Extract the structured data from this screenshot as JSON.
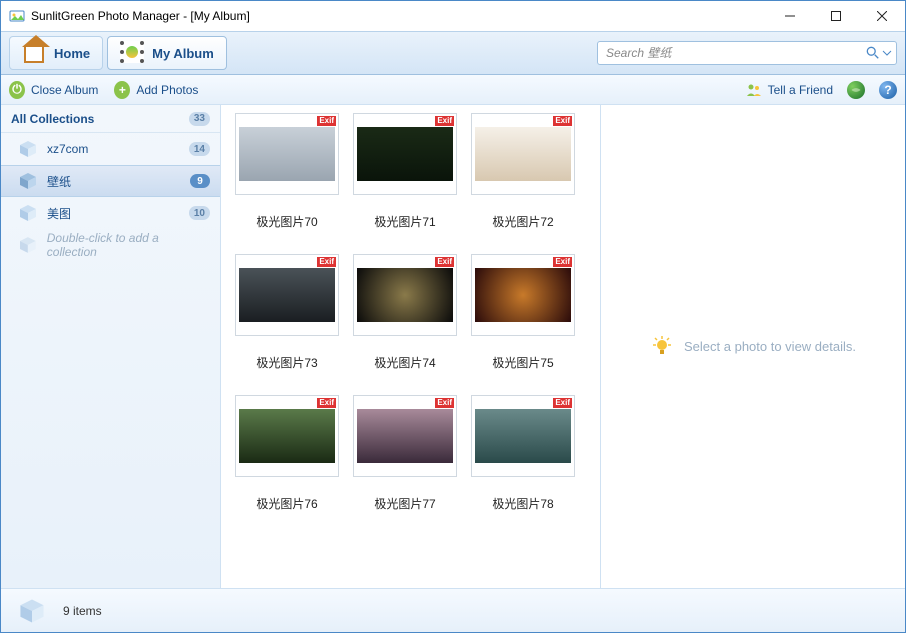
{
  "window": {
    "title": "SunlitGreen Photo Manager - [My Album]"
  },
  "nav": {
    "home": "Home",
    "album": "My Album"
  },
  "search": {
    "placeholder": "Search 壁纸"
  },
  "toolbar": {
    "close_album": "Close Album",
    "add_photos": "Add Photos",
    "tell_friend": "Tell a Friend"
  },
  "sidebar": {
    "header": "All Collections",
    "total_count": "33",
    "items": [
      {
        "label": "xz7com",
        "count": "14",
        "selected": false
      },
      {
        "label": "壁纸",
        "count": "9",
        "selected": true
      },
      {
        "label": "美图",
        "count": "10",
        "selected": false
      }
    ],
    "add_hint": "Double-click to add a collection"
  },
  "thumbs": [
    {
      "label": "极光图片70",
      "exif": "Exif",
      "cls": "t70"
    },
    {
      "label": "极光图片71",
      "exif": "Exif",
      "cls": "t71"
    },
    {
      "label": "极光图片72",
      "exif": "Exif",
      "cls": "t72"
    },
    {
      "label": "极光图片73",
      "exif": "Exif",
      "cls": "t73"
    },
    {
      "label": "极光图片74",
      "exif": "Exif",
      "cls": "t74"
    },
    {
      "label": "极光图片75",
      "exif": "Exif",
      "cls": "t75"
    },
    {
      "label": "极光图片76",
      "exif": "Exif",
      "cls": "t76"
    },
    {
      "label": "极光图片77",
      "exif": "Exif",
      "cls": "t77"
    },
    {
      "label": "极光图片78",
      "exif": "Exif",
      "cls": "t78"
    }
  ],
  "detail": {
    "empty": "Select a photo to view details."
  },
  "status": {
    "text": "9 items"
  }
}
